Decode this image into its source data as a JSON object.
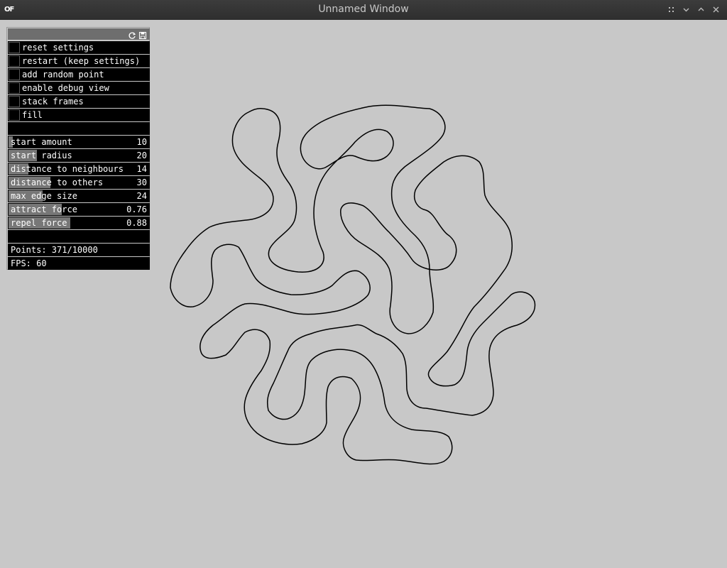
{
  "window": {
    "title": "Unnamed Window",
    "logo": "OF"
  },
  "icons": {
    "reload": "reload-icon",
    "save": "save-icon",
    "menu": "grip-icon",
    "minimize": "chevron-down-icon",
    "maximize": "chevron-up-icon",
    "close": "close-icon"
  },
  "gui": {
    "toggles": [
      {
        "label": "reset settings",
        "checked": false
      },
      {
        "label": "restart (keep settings)",
        "checked": false
      },
      {
        "label": "add random point",
        "checked": false
      },
      {
        "label": "enable debug view",
        "checked": false
      },
      {
        "label": "stack frames",
        "checked": false
      },
      {
        "label": "fill",
        "checked": false
      }
    ],
    "sliders": [
      {
        "label": "start amount",
        "value": "10",
        "level": 0.03
      },
      {
        "label": "start radius",
        "value": "20",
        "level": 0.2
      },
      {
        "label": "distance to neighbours",
        "value": "14",
        "level": 0.14
      },
      {
        "label": "distance to others",
        "value": "30",
        "level": 0.3
      },
      {
        "label": "max edge size",
        "value": "24",
        "level": 0.24
      },
      {
        "label": "attract force",
        "value": "0.76",
        "level": 0.38
      },
      {
        "label": "repel force",
        "value": "0.88",
        "level": 0.44
      }
    ],
    "points": "Points: 371/10000",
    "fps": "FPS: 60"
  }
}
